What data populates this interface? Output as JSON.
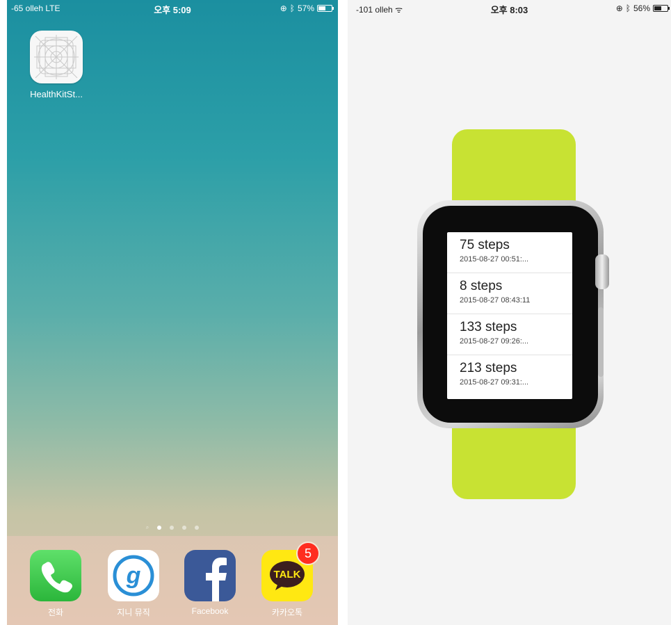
{
  "left_phone": {
    "status_bar": {
      "carrier": "-65 olleh  LTE",
      "time": "오후 5:09",
      "battery": "57%",
      "battery_level": 0.57
    },
    "home_app": {
      "label": "HealthKitSt..."
    },
    "page_dots": {
      "count": 5,
      "active_index": 1
    },
    "dock": [
      {
        "name": "phone",
        "label": "전화"
      },
      {
        "name": "genie-music",
        "label": "지니 뮤직"
      },
      {
        "name": "facebook",
        "label": "Facebook"
      },
      {
        "name": "kakaotalk",
        "label": "카카오톡",
        "badge": "5",
        "icon_text": "TALK"
      }
    ]
  },
  "right_phone": {
    "status_bar": {
      "carrier": "-101 olleh",
      "time": "오후 8:03",
      "battery": "56%",
      "battery_level": 0.56
    },
    "watch_list": [
      {
        "steps": "75 steps",
        "date": "2015-08-27 00:51:..."
      },
      {
        "steps": "8 steps",
        "date": "2015-08-27 08:43:11"
      },
      {
        "steps": "133 steps",
        "date": "2015-08-27 09:26:..."
      },
      {
        "steps": "213 steps",
        "date": "2015-08-27 09:31:..."
      }
    ]
  },
  "colors": {
    "band": "#c8e233",
    "badge": "#ff2d20",
    "facebook": "#3b5998",
    "kakao": "#ffe812",
    "phone": "#36c24a"
  }
}
